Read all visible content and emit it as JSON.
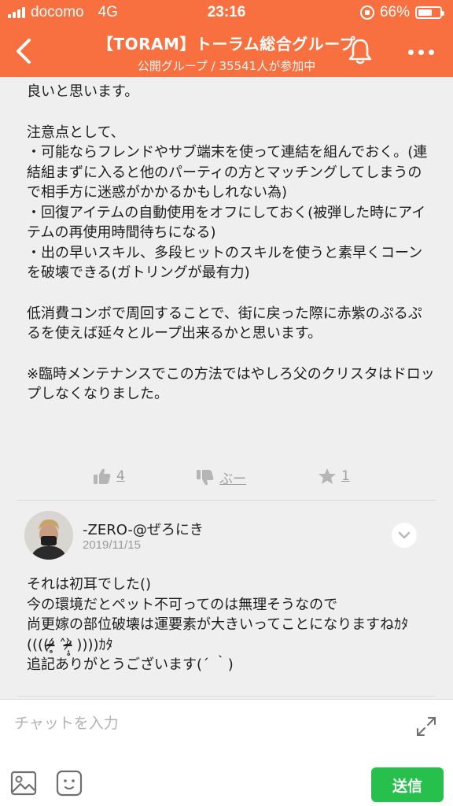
{
  "status_bar": {
    "carrier": "docomo",
    "network": "4G",
    "time": "23:16",
    "battery": "66%",
    "battery_level": 0.66
  },
  "header": {
    "title": "【TORAM】トーラム総合グループ",
    "subtitle": "公開グループ / 35541人が参加中"
  },
  "post": {
    "paragraphs": [
      "良いと思います。",
      "注意点として、\n・可能ならフレンドやサブ端末を使って連結を組んでおく。(連結組まずに入ると他のパーティの方とマッチングしてしまうので相手方に迷惑がかかるかもしれない為)\n・回復アイテムの自動使用をオフにしておく(被弾した時にアイテムの再使用時間待ちになる)\n・出の早いスキル、多段ヒットのスキルを使うと素早くコーンを破壊できる(ガトリングが最有力)",
      "低消費コンボで周回することで、街に戻った際に赤紫のぷるぷるを使えば延々とループ出来るかと思います。",
      "※臨時メンテナンスでこの方法ではやしろ父のクリスタはドロップしなくなりました。"
    ],
    "reactions": {
      "like_count": "4",
      "boo_label": "ぶー",
      "star_count": "1"
    }
  },
  "comment": {
    "author": "-ZERO-@ぜろにき",
    "date": "2019/11/15",
    "text": "それは初耳でした()\n今の環境だとペット不可ってのは無理そうなので\n尚更嫁の部位破壊は運要素が大きいってことになりますねｶﾀ((((ᵒ̴̶̷̥́ ˄ᵒ̴̶̷̣̥̀ ))))ｶﾀ\n追記ありがとうございます(´ ｀)"
  },
  "input_bar": {
    "placeholder": "チャットを入力",
    "send_label": "送信"
  },
  "colors": {
    "brand": "#f8703f",
    "send": "#27c04c",
    "background": "#efefef"
  }
}
